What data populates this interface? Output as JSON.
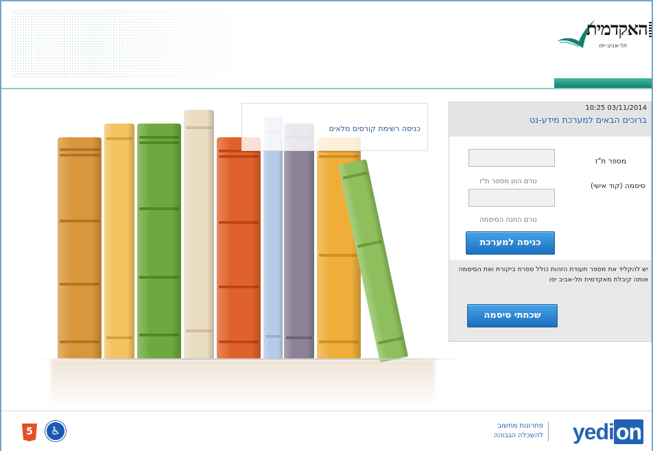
{
  "header": {
    "logo_text": "האקדמית",
    "logo_subtitle": "תל-אביב-יפו"
  },
  "main": {
    "course_link": "כניסה רשימת קורסים מלאים"
  },
  "login": {
    "datetime": "10:25 03/11/2014",
    "title": "ברוכים הבאים למערכת מידע-נט",
    "id_label": "מספר ת\"ז",
    "id_hint": "טרם הוזן מספר ת\"ז",
    "password_label": "סיסמה (קוד אישי)",
    "password_hint": "טרם הוזנה הסיסמה",
    "login_button": "כניסה למערכת",
    "info_text": "יש להקליד את מספר תעודת הזהות כולל ספרת ביקורת ואת הסיסמה אותה קיבלת מאקדמית תל-אביב יפו",
    "forgot_button": "שכחתי סיסמה"
  },
  "footer": {
    "html5_badge": "5",
    "accessibility_icon": "wheelchair-icon",
    "yedion_brand": "yedi",
    "yedion_brand_on": "on",
    "yedion_tagline1": "פתרונות מחשוב",
    "yedion_tagline2": "להשכלה הגבוהה"
  },
  "colors": {
    "accent_blue": "#1f63b0",
    "button_blue": "#1b6fc0",
    "header_green": "#11806f"
  }
}
